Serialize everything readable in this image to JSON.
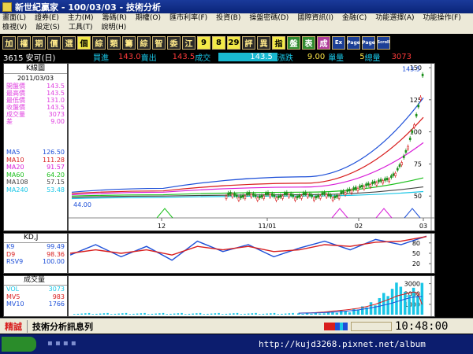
{
  "window": {
    "title": "新世紀贏家 - 100/03/03 - 技術分析"
  },
  "menu": {
    "row1": [
      "畫面(L)",
      "證券(E)",
      "主力(M)",
      "籌碼(R)",
      "期權(O)",
      "匯市利率(F)",
      "投資(B)",
      "操盤密碼(D)",
      "國際資訊(I)",
      "金融(C)",
      "功能選擇(A)",
      "功能操作(F)"
    ],
    "row2": [
      "檢視(V)",
      "設定(S)",
      "工具(T)",
      "說明(H)"
    ]
  },
  "toolbar": {
    "buttons": [
      "加",
      "權",
      "期",
      "價",
      "選",
      "個",
      "綜",
      "類",
      "籌",
      "綜",
      "智",
      "委",
      "江",
      "9",
      "8",
      "29",
      "評",
      "異",
      "指",
      "盤",
      "表",
      "成",
      "Ex",
      "Page",
      "Page",
      "Scroll"
    ]
  },
  "quote_bar": {
    "symbol": "3615 安可(日)",
    "buy_label": "買進",
    "buy_value": "143.0",
    "sell_label": "賣出",
    "sell_value": "143.5",
    "trade_label": "成交",
    "trade_value": "143.5",
    "change_label": "漲跌",
    "change_value": "9.00",
    "lot_label": "單量",
    "lot_value": "5",
    "total_label": "總量",
    "total_value": "3073"
  },
  "left_panel": {
    "title": "K線圖",
    "date": "2011/03/03",
    "quote_rows": [
      {
        "label": "開盤價",
        "value": "143.5"
      },
      {
        "label": "最高價",
        "value": "143.5"
      },
      {
        "label": "最低價",
        "value": "131.0"
      },
      {
        "label": "收盤價",
        "value": "143.5"
      },
      {
        "label": "成交量",
        "value": "3073"
      },
      {
        "label": "差",
        "value": "9.00"
      }
    ],
    "ma_rows": [
      {
        "label": "MA5",
        "value": "126.50",
        "color": "#1d4fd8"
      },
      {
        "label": "MA10",
        "value": "111.28",
        "color": "#d81d1d"
      },
      {
        "label": "MA20",
        "value": "91.57",
        "color": "#d81dd8"
      },
      {
        "label": "MA60",
        "value": "64.20",
        "color": "#1bbf1b"
      },
      {
        "label": "MA108",
        "value": "57.15",
        "color": "#444444"
      },
      {
        "label": "MA240",
        "value": "53.48",
        "color": "#19c6e6"
      }
    ]
  },
  "kd_panel": {
    "title": "KD,J",
    "rows": [
      {
        "label": "K9",
        "value": "99.49",
        "color": "#1d4fd8"
      },
      {
        "label": "D9",
        "value": "98.36",
        "color": "#d81d1d"
      },
      {
        "label": "RSV9",
        "value": "100.00",
        "color": "#1d4fd8"
      }
    ]
  },
  "volume_panel": {
    "title": "成交量",
    "rows": [
      {
        "label": "VOL",
        "value": "3073",
        "color": "#19c6e6"
      },
      {
        "label": "MV5",
        "value": "983",
        "color": "#d81d1d"
      },
      {
        "label": "MV10",
        "value": "1766",
        "color": "#1d4fd8"
      }
    ]
  },
  "main_chart": {
    "y_ticks": [
      "150",
      "125",
      "100",
      "75",
      "50"
    ],
    "x_ticks": [
      "12",
      "11/01",
      "02",
      "03"
    ],
    "high_label": "143.5",
    "low_label": "44.00"
  },
  "kd_chart": {
    "y_ticks": [
      "80",
      "50",
      "20"
    ]
  },
  "volume_chart": {
    "y_ticks": [
      "3000",
      "2000",
      "1000"
    ]
  },
  "chart_data": [
    {
      "type": "line",
      "title": "K線圖",
      "x": [
        "12",
        "11/01",
        "02",
        "03"
      ],
      "series": [
        {
          "name": "MA5",
          "values": [
            53.0,
            56.0,
            65.0,
            126.5
          ]
        },
        {
          "name": "MA10",
          "values": [
            52.0,
            54.0,
            60.0,
            111.28
          ]
        },
        {
          "name": "MA20",
          "values": [
            51.0,
            53.0,
            57.0,
            91.57
          ]
        },
        {
          "name": "MA60",
          "values": [
            50.0,
            51.0,
            53.0,
            64.2
          ]
        },
        {
          "name": "MA108",
          "values": [
            49.0,
            50.0,
            51.0,
            57.15
          ]
        },
        {
          "name": "MA240",
          "values": [
            48.0,
            49.0,
            50.0,
            53.48
          ]
        }
      ],
      "ylim": [
        44,
        150
      ]
    },
    {
      "type": "line",
      "title": "KD,J",
      "series": [
        {
          "name": "K9",
          "values": [
            45,
            75,
            40,
            70,
            30,
            85,
            55,
            75,
            40,
            65,
            85,
            60,
            90,
            75,
            99.49
          ]
        },
        {
          "name": "D9",
          "values": [
            50,
            60,
            50,
            60,
            45,
            70,
            60,
            70,
            55,
            60,
            75,
            70,
            82,
            85,
            98.36
          ]
        }
      ],
      "ylim": [
        0,
        100
      ]
    },
    {
      "type": "bar",
      "title": "成交量",
      "series": [
        {
          "name": "VOL",
          "values": [
            120,
            80,
            150,
            90,
            200,
            110,
            130,
            300,
            250,
            180,
            400,
            350,
            220,
            600,
            500,
            800,
            700,
            1200,
            900,
            1600,
            2100,
            1800,
            2500,
            3100,
            2700,
            2200,
            1900,
            2600,
            1800,
            3073
          ]
        },
        {
          "name": "MV5",
          "values": [
            150,
            160,
            170,
            180,
            200,
            230,
            260,
            300,
            350,
            380,
            420,
            460,
            500,
            560,
            620,
            700,
            780,
            900,
            1000,
            1150,
            1300,
            1450,
            1600,
            1800,
            1900,
            2000,
            2100,
            2200,
            2100,
            983
          ]
        },
        {
          "name": "MV10",
          "values": [
            140,
            150,
            155,
            160,
            170,
            180,
            200,
            220,
            250,
            280,
            300,
            330,
            370,
            410,
            460,
            520,
            590,
            660,
            740,
            820,
            920,
            1020,
            1120,
            1250,
            1380,
            1500,
            1620,
            1700,
            1740,
            1766
          ]
        }
      ],
      "ylim": [
        0,
        3500
      ]
    }
  ],
  "status": {
    "label": "精誠",
    "ticker": "技術分析訊息列",
    "time": "10:48:00"
  },
  "taskbar": {
    "url": "http://kujd3268.pixnet.net/album"
  }
}
